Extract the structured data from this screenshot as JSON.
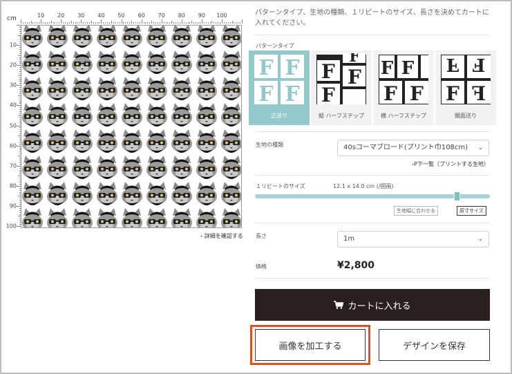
{
  "preview": {
    "unit": "cm",
    "top_ticks": [
      "10",
      "20",
      "30",
      "40",
      "50",
      "60",
      "70",
      "80",
      "90",
      "100"
    ],
    "left_ticks": [
      "10",
      "20",
      "30",
      "40",
      "50",
      "60",
      "70",
      "80",
      "90",
      "100"
    ],
    "details_link": "› 詳細を確認する"
  },
  "description": "パターンタイプ、生地の種類、１リピートのサイズ、長さを決めてカートに入れてください。",
  "pattern": {
    "label": "パターンタイプ",
    "options": [
      {
        "label": "正送り",
        "selected": true
      },
      {
        "label": "縦 ハーフステップ",
        "selected": false
      },
      {
        "label": "横 ハーフステップ",
        "selected": false
      },
      {
        "label": "鏡面送り",
        "selected": false
      }
    ]
  },
  "fabric": {
    "label": "生地の種類",
    "value": "40sコーマブロード(プリント巾108cm)",
    "list_link": "›P下一覧（プリントする生地）"
  },
  "repeat": {
    "label": "１リピートのサイズ",
    "value": "12.1 x 14.0 cm (/固画)",
    "level": 0.86,
    "fit_button": "生地幅に合わせる",
    "original_button": "原寸サイズ"
  },
  "length": {
    "label": "長さ",
    "value": "1m"
  },
  "price": {
    "label": "価格",
    "value": "¥2,800"
  },
  "buttons": {
    "cart": "カートに入れる",
    "edit": "画像を加工する",
    "save": "デザインを保存"
  },
  "colors": {
    "accent": "#93c8cc",
    "dark": "#2a2020",
    "highlight": "#e0511f"
  }
}
